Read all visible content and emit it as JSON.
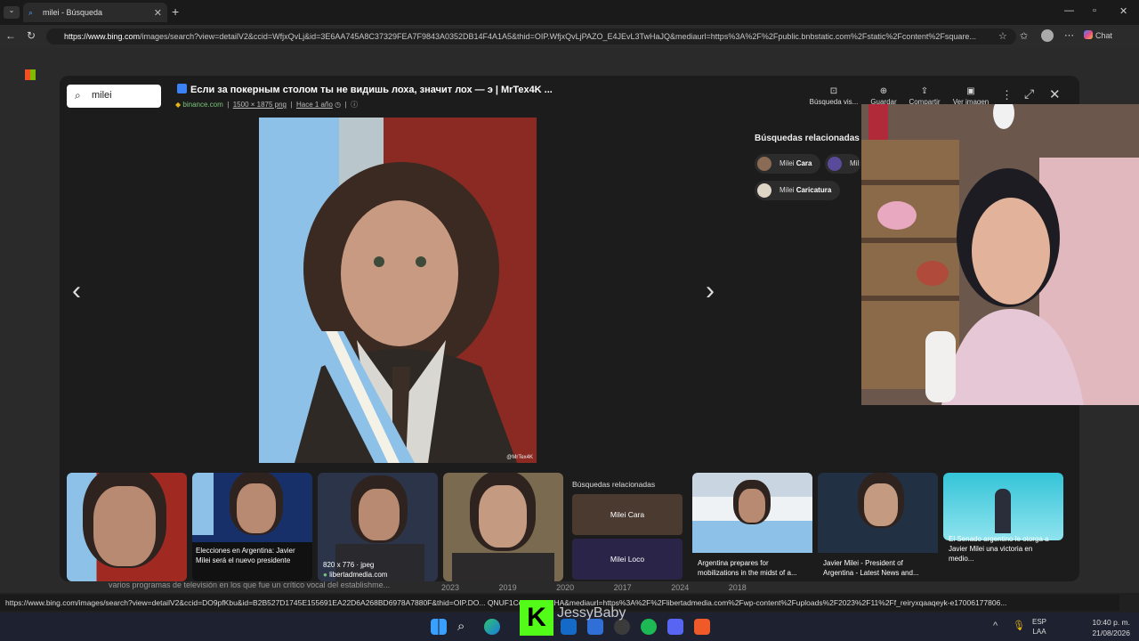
{
  "browser": {
    "tab_title": "milei - Búsqueda",
    "url_host": "https://www.bing.com",
    "url_path": "/images/search?view=detailV2&ccid=WfjxQvLj&id=3E6AA745A8C37329FEA7F9843A0352DB14F4A1A5&thid=OIP.WfjxQvLjPAZO_E4JEvL3TwHaJQ&mediaurl=https%3A%2F%2Fpublic.bnbstatic.com%2Fstatic%2Fcontent%2Fsquare...",
    "chat_label": "Chat"
  },
  "viewer": {
    "search_value": "milei",
    "title": "Если за покерным столом ты не видишь лоха, значит лох — э | MrTex4K ...",
    "source": "binance.com",
    "dimensions": "1500 × 1875 png",
    "age": "Hace 1 año",
    "tools": [
      "Búsqueda vis...",
      "Guardar",
      "Compartir",
      "Ver imagen"
    ],
    "image_credit": "@MrTex4K",
    "related_title": "Búsquedas relacionadas",
    "related": [
      {
        "prefix": "Milei",
        "bold": "Cara"
      },
      {
        "prefix": "Mil",
        "bold": ""
      },
      {
        "prefix": "Milei",
        "bold": "Caricatura"
      }
    ]
  },
  "thumbs": [
    {
      "caption": ""
    },
    {
      "caption": "Elecciones en Argentina: Javier Milei será el nuevo presidente"
    },
    {
      "caption": "820 x 776 · jpeg",
      "source": "libertadmedia.com"
    },
    {
      "caption": ""
    },
    {
      "title": "Búsquedas relacionadas",
      "a": "Milei Cara",
      "b": "Milei Loco"
    },
    {
      "caption": "Argentina prepares for mobilizations in the midst of a..."
    },
    {
      "caption": "Javier Milei - President of Argentina - Latest News and..."
    },
    {
      "caption": "El Senado argentino le otorga a Javier Milei una victoria en medio..."
    }
  ],
  "background_text": "varios programas de televisión en los que fue un crítico vocal del establishme...",
  "years": [
    "2023",
    "2019",
    "2020",
    "2017",
    "2024",
    "2018"
  ],
  "status_url": "https://www.bing.com/images/search?view=detailV2&ccid=DO9pfKbu&id=B2B527D1745E155691EA22D6A268BD6978A7880F&thid=OIP.DO... QNUF1CoX6fQgHaHA&mediaurl=https%3A%2F%2Flibertadmedia.com%2Fwp-content%2Fuploads%2F2023%2F11%2Ff_reiryxqaaqeyk-e17006177806...",
  "watermark": "JessyBaby",
  "system": {
    "lang1": "ESP",
    "lang2": "LAA",
    "time": "10:40 p. m.",
    "date": "21/08/2026"
  },
  "colors": {
    "accent": "#3b82f6",
    "overlay": "#1c1c1c",
    "argentina_blue": "#8ec1e8"
  }
}
